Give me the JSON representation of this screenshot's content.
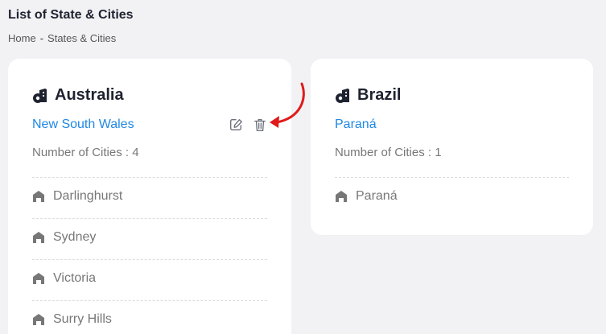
{
  "header": {
    "title": "List of State & Cities",
    "breadcrumb": [
      "Home",
      "-",
      "States & Cities"
    ]
  },
  "cards": [
    {
      "country": "Australia",
      "state": "New South Wales",
      "num_cities_label": "Number of Cities : 4",
      "cities": [
        "Darlinghurst",
        "Sydney",
        "Victoria",
        "Surry Hills"
      ],
      "actions": {
        "edit_icon": "edit-icon",
        "delete_icon": "trash-icon"
      }
    },
    {
      "country": "Brazil",
      "state": "Paraná",
      "num_cities_label": "Number of Cities : 1",
      "cities": [
        "Paraná"
      ]
    }
  ],
  "colors": {
    "accent": "#1e88e5",
    "annotation_arrow": "#e01b1b",
    "background": "#f2f2f5",
    "muted_text": "#777777"
  }
}
